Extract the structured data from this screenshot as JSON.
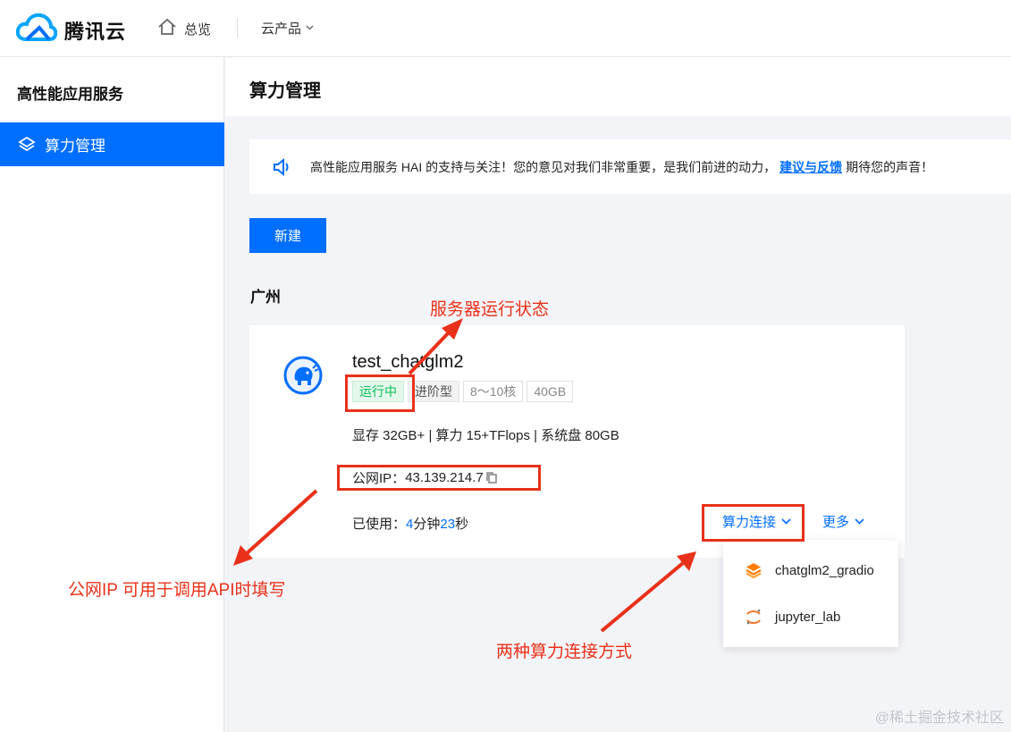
{
  "topbar": {
    "brand": "腾讯云",
    "home_label": "总览",
    "products_label": "云产品"
  },
  "sidebar": {
    "title": "高性能应用服务",
    "items": [
      {
        "label": "算力管理",
        "active": true
      }
    ]
  },
  "page": {
    "title": "算力管理"
  },
  "notice": {
    "text_before": "高性能应用服务 HAI 的支持与关注！您的意见对我们非常重要，是我们前进的动力，",
    "link_text": "建议与反馈",
    "text_after": "期待您的声音！"
  },
  "toolbar": {
    "new_label": "新建"
  },
  "region": "广州",
  "instance": {
    "name": "test_chatglm2",
    "status": "运行中",
    "tier": "进阶型",
    "cores": "8～10核",
    "memory": "40GB",
    "specs": "显存 32GB+ | 算力 15+TFlops | 系统盘 80GB",
    "ip_label": "公网IP：",
    "ip": "43.139.214.7",
    "used_label": "已使用：",
    "used_min": "4",
    "used_min_unit": "分钟",
    "used_sec": "23",
    "used_sec_unit": "秒",
    "connect_label": "算力连接",
    "more_label": "更多"
  },
  "connect_menu": [
    {
      "label": "chatglm2_gradio",
      "icon": "gradio-icon"
    },
    {
      "label": "jupyter_lab",
      "icon": "jupyter-icon"
    }
  ],
  "annotations": {
    "status": "服务器运行状态",
    "ip": "公网IP 可用于调用API时填写",
    "connect": "两种算力连接方式"
  },
  "watermark": "@稀土掘金技术社区",
  "colors": {
    "accent": "#006eff",
    "running": "#0abf5b",
    "annotation": "#e8311a"
  }
}
